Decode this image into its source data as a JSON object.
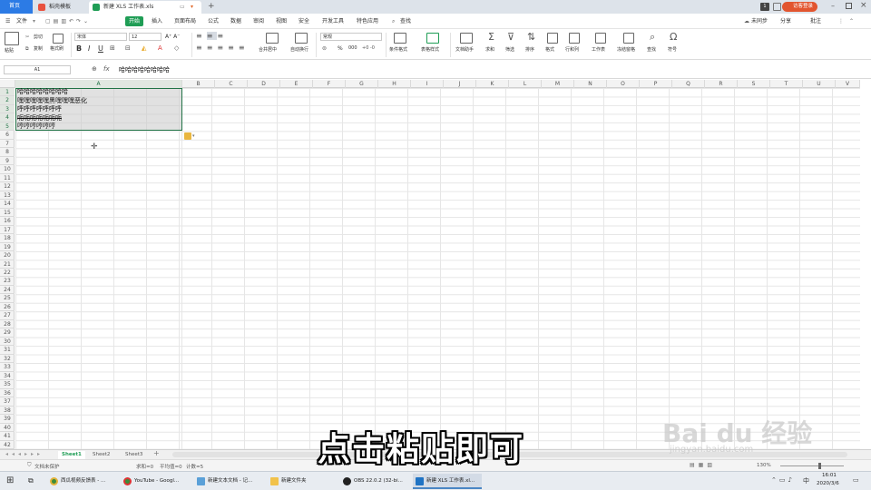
{
  "tabs": {
    "home": "首页",
    "docer": "稻壳模板",
    "document": "新建 XLS 工作表.xls",
    "add": "+"
  },
  "window": {
    "count": "1",
    "login": "访客登录"
  },
  "menu": {
    "file": "文件",
    "items": [
      "开始",
      "插入",
      "页面布局",
      "公式",
      "数据",
      "审阅",
      "视图",
      "安全",
      "开发工具",
      "特色应用"
    ],
    "search": "查找",
    "sync": "未同步",
    "share": "分享",
    "comment": "批注"
  },
  "ribbon": {
    "paste": "粘贴",
    "cut": "剪切",
    "copy": "复制",
    "format_painter": "格式刷",
    "font_name": "宋体",
    "font_size": "12",
    "bold": "B",
    "italic": "I",
    "underline": "U",
    "merge": "合并居中",
    "wrap": "自动换行",
    "number_format": "常规",
    "cond_format": "条件格式",
    "table_style": "表格样式",
    "doc_helper": "文档助手",
    "sum": "求和",
    "filter": "筛选",
    "sort": "排序",
    "format": "格式",
    "row_col": "行和列",
    "worksheet": "工作表",
    "freeze": "冻结窗格",
    "find": "查找",
    "symbol": "符号",
    "percent": "%",
    "thousands": "000"
  },
  "formula_bar": {
    "cell_ref": "A1",
    "fx": "fx",
    "content": "哈哈哈哈哈哈哈哈"
  },
  "columns": [
    "A",
    "B",
    "C",
    "D",
    "E",
    "F",
    "G",
    "H",
    "I",
    "J",
    "K",
    "L",
    "M",
    "N",
    "O",
    "P",
    "Q",
    "R",
    "S",
    "T",
    "U",
    "V"
  ],
  "rows": [
    "1",
    "2",
    "3",
    "4",
    "5",
    "6",
    "7",
    "8",
    "9",
    "10",
    "11",
    "12",
    "13",
    "14",
    "15",
    "16",
    "17",
    "18",
    "19",
    "20",
    "21",
    "22",
    "23",
    "24",
    "25",
    "26",
    "27",
    "28",
    "29",
    "30",
    "31",
    "32",
    "33",
    "34",
    "35",
    "36",
    "37",
    "38",
    "39",
    "40",
    "41",
    "42"
  ],
  "cells": [
    "哈哈哈哈哈哈哈哈",
    "嘿嘿嘿嘿嘿黑嘿嘿嘿恶化",
    "呼呼呼呼呼呼呼",
    "呃呃呃呃呃呃呃",
    "哼哼哼哼哼哼"
  ],
  "sheets": [
    "Sheet1",
    "Sheet2",
    "Sheet3"
  ],
  "sheet_add": "+",
  "status": {
    "protect": "文档未保护",
    "sum": "求和=0",
    "avg": "平均值=0",
    "count": "计数=5",
    "zoom": "130%"
  },
  "taskbar": {
    "apps": [
      "西瓜视频反馈表 - ...",
      "YouTube - Googl...",
      "新建文本文档 - 记...",
      "新建文件夹",
      "OBS 22.0.2 (32-bi...",
      "新建 XLS 工作表.xl..."
    ],
    "lang": "中",
    "time": "16:01",
    "date": "2020/3/6"
  },
  "overlay": {
    "subtitle": "点击粘贴即可",
    "watermark": "Bai du 经验",
    "watermark_sub": "jingyan.baidu.com"
  },
  "colors": {
    "accent_green": "#1f9d55",
    "home_tab_blue": "#2c7be5",
    "selection_border": "#217346"
  }
}
